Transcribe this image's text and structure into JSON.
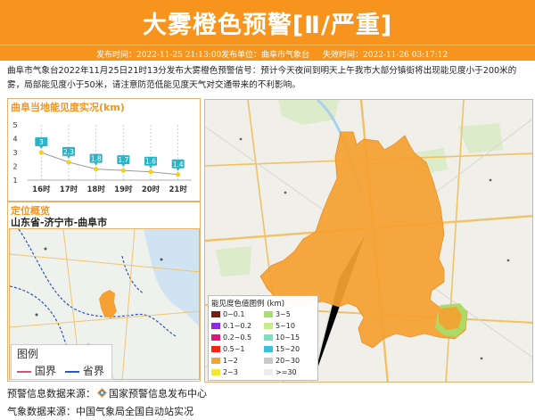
{
  "header": {
    "title": "大雾橙色预警[Ⅱ/严重]",
    "publish_time": "发布时间：2022-11-25 21:13:00",
    "publisher": "发布单位：曲阜市气象台",
    "expire_time": "失效时间：2022-11-26 03:17:12"
  },
  "warning_text": "曲阜市气象台2022年11月25日21时13分发布大雾橙色预警信号：预计今天夜间到明天上午我市大部分镇街将出现能见度小于200米的雾，局部能见度小于50米，请注意防范低能见度天气对交通带来的不利影响。",
  "visibility_section": {
    "title": "曲阜当地能见度实况(km)"
  },
  "chart_data": {
    "type": "line",
    "title": "曲阜当地能见度实况(km)",
    "xlabel": "",
    "ylabel": "",
    "categories": [
      "16时",
      "17时",
      "18时",
      "19时",
      "20时",
      "21时"
    ],
    "series": [
      {
        "values": [
          3,
          2.3,
          1.8,
          1.7,
          1.6,
          1.4
        ]
      }
    ],
    "value_labels": [
      "3",
      "2.3",
      "1.8",
      "1.7",
      "1.6",
      "1.4"
    ],
    "y_ticks": [
      "1",
      "2",
      "3",
      "4",
      "5"
    ],
    "ylim": [
      1,
      5
    ],
    "grid": true,
    "colors": {
      "line": "#9b9b9b",
      "label_bg": "#2db3c8",
      "point": "#ffd400"
    }
  },
  "location_section": {
    "title": "定位概览",
    "location": "山东省-济宁市-曲阜市"
  },
  "mini_map_legend": {
    "title": "图例",
    "items": [
      {
        "label": "国界",
        "color": "#c85a74"
      },
      {
        "label": "省界",
        "color": "#2a56c6"
      }
    ]
  },
  "legend": {
    "title": "能见度色值图例 (km)",
    "items": [
      {
        "label": "0~0.1",
        "color": "#7a1b0c"
      },
      {
        "label": "3~5",
        "color": "#a5e06c"
      },
      {
        "label": "0.1~0.2",
        "color": "#8a2be2"
      },
      {
        "label": "5~10",
        "color": "#c7ea8c"
      },
      {
        "label": "0.2~0.5",
        "color": "#e0147d"
      },
      {
        "label": "10~15",
        "color": "#7de0c0"
      },
      {
        "label": "0.5~1",
        "color": "#ff2010"
      },
      {
        "label": "15~20",
        "color": "#3fbfe0"
      },
      {
        "label": "1~2",
        "color": "#f5a030"
      },
      {
        "label": "20~30",
        "color": "#c8c8c8"
      },
      {
        "label": "2~3",
        "color": "#f3e830"
      },
      {
        "label": ">=30",
        "color": "#ececec"
      }
    ]
  },
  "footer": {
    "warning_source_prefix": "预警信息数据来源：",
    "warning_source_name": "国家预警信息发布中心",
    "weather_source": "气象数据来源：中国气象局全国自动站实况"
  },
  "colors": {
    "accent": "#f7941d",
    "fog_area": "#f5a030",
    "fog_area_light": "#a5e06c"
  }
}
